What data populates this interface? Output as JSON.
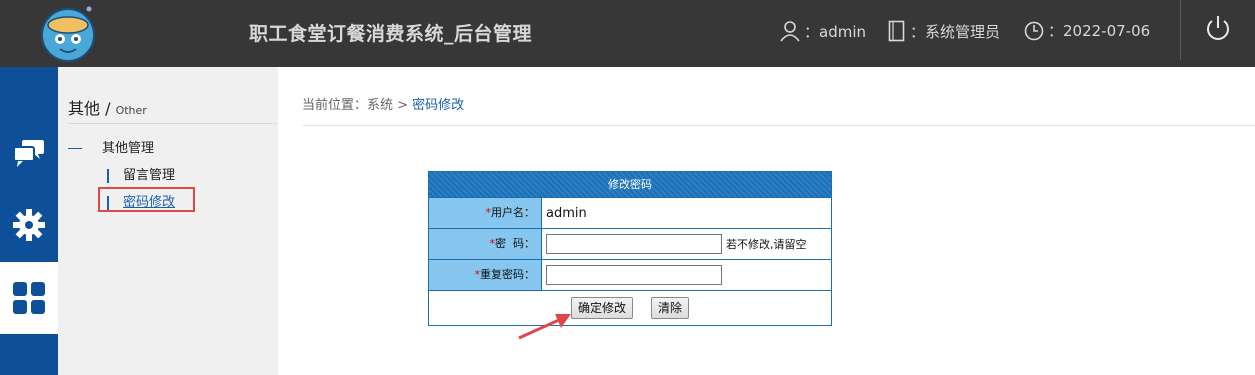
{
  "header": {
    "title": "职工食堂订餐消费系统_后台管理",
    "user_label": "：admin",
    "role_label": "：系统管理员",
    "date_label": "：2022-07-06",
    "icons": [
      "user-icon",
      "book-icon",
      "clock-icon",
      "power-icon"
    ]
  },
  "iconbar": {
    "items": [
      {
        "icon": "chat-icon"
      },
      {
        "icon": "gear-icon"
      },
      {
        "icon": "grid-icon",
        "active": true
      }
    ]
  },
  "sidebar": {
    "title": "其他",
    "title_sep": " / ",
    "title_en": "Other",
    "group": "其他管理",
    "items": [
      {
        "label": "留言管理"
      },
      {
        "label": "密码修改",
        "active": true
      }
    ]
  },
  "breadcrumb": {
    "prefix": "当前位置：系统 > ",
    "current": "密码修改"
  },
  "form": {
    "header": "修改密码",
    "username_label": "用户名：",
    "username_value": "admin",
    "password_label": "密  码：",
    "password_hint": "若不修改,请留空",
    "repeat_label": "重复密码：",
    "submit_label": "确定修改",
    "clear_label": "清除",
    "required_mark": "*"
  },
  "colors": {
    "topbar": "#373737",
    "iconbar": "#0d4f98",
    "accent": "#1a5fb4",
    "highlight": "#e04848"
  }
}
